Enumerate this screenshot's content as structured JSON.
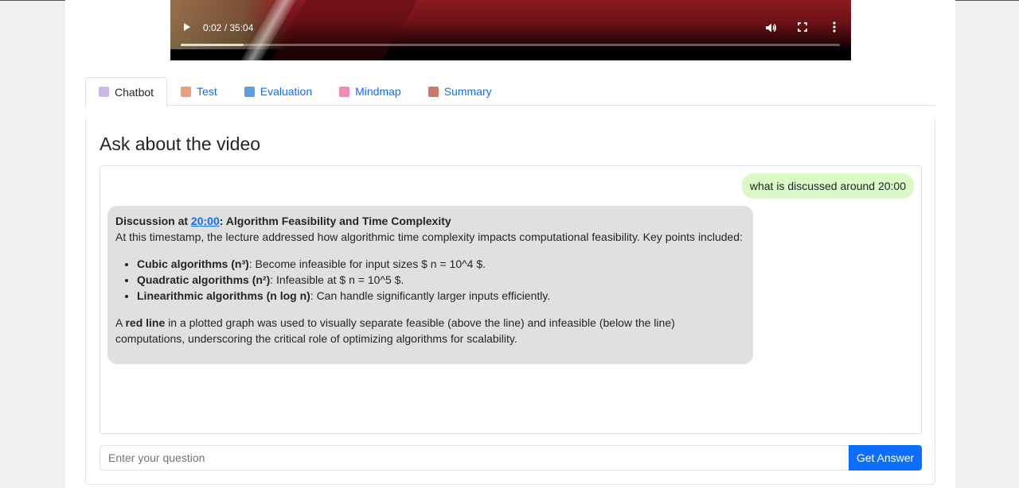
{
  "video": {
    "time_display": "0:02 / 35:04",
    "progress_fraction": 0.0009
  },
  "tabs": [
    {
      "label": "Chatbot",
      "icon": "speech-bubble-icon",
      "color": "#c9b8e8",
      "active": true
    },
    {
      "label": "Test",
      "icon": "memo-icon",
      "color": "#e8a07a",
      "active": false
    },
    {
      "label": "Evaluation",
      "icon": "bar-chart-icon",
      "color": "#5aa0e0",
      "active": false
    },
    {
      "label": "Mindmap",
      "icon": "brain-icon",
      "color": "#f08bb8",
      "active": false
    },
    {
      "label": "Summary",
      "icon": "clipboard-icon",
      "color": "#c97a6a",
      "active": false
    }
  ],
  "panel": {
    "title": "Ask about the video"
  },
  "chat": {
    "user_message": "what is discussed around 20:00",
    "bot": {
      "heading_prefix": "Discussion at ",
      "heading_link": "20:00",
      "heading_suffix": ": Algorithm Feasibility and Time Complexity",
      "intro": "At this timestamp, the lecture addressed how algorithmic time complexity impacts computational feasibility. Key points included:",
      "bullets": [
        {
          "bold": "Cubic algorithms (n³)",
          "text": ": Become infeasible for input sizes $ n = 10^4 $."
        },
        {
          "bold": "Quadratic algorithms (n²)",
          "text": ": Infeasible at $ n = 10^5 $."
        },
        {
          "bold": "Linearithmic algorithms (n log n)",
          "text": ": Can handle significantly larger inputs efficiently."
        }
      ],
      "closing_prefix": "A ",
      "closing_bold": "red line",
      "closing_text": " in a plotted graph was used to visually separate feasible (above the line) and infeasible (below the line) computations, underscoring the critical role of optimizing algorithms for scalability."
    }
  },
  "input": {
    "placeholder": "Enter your question",
    "value": "",
    "button_label": "Get Answer"
  }
}
